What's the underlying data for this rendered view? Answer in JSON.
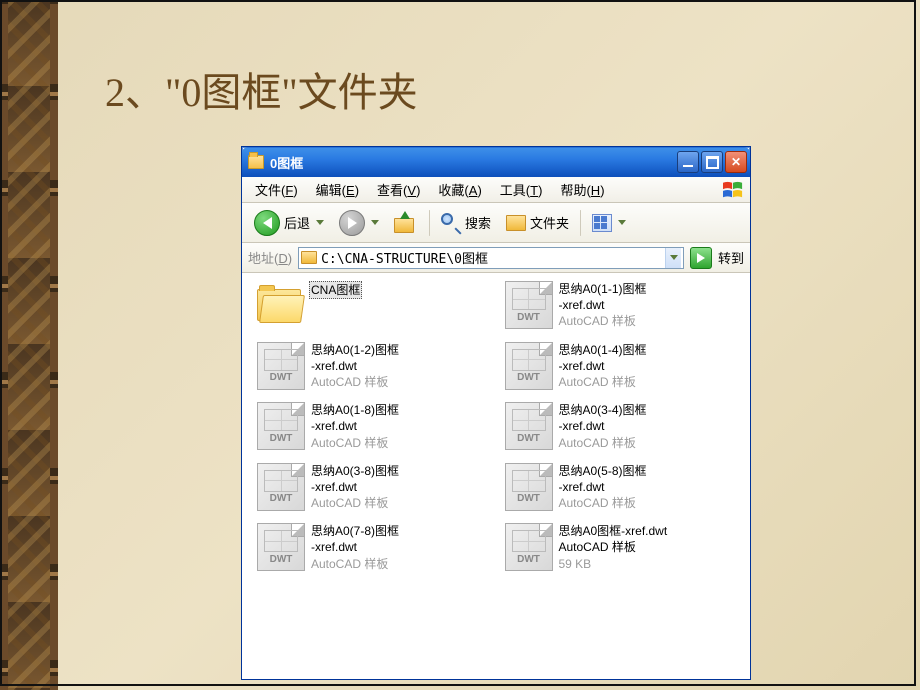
{
  "slide": {
    "title": "2、\"0图框\"文件夹"
  },
  "window": {
    "caption": "0图框"
  },
  "menu": {
    "file": "文件",
    "file_key": "F",
    "edit": "编辑",
    "edit_key": "E",
    "view": "查看",
    "view_key": "V",
    "fav": "收藏",
    "fav_key": "A",
    "tool": "工具",
    "tool_key": "T",
    "help": "帮助",
    "help_key": "H"
  },
  "toolbar": {
    "back": "后退",
    "search": "搜索",
    "folders": "文件夹"
  },
  "address": {
    "label": "地址",
    "label_key": "D",
    "path": "C:\\CNA-STRUCTURE\\0图框",
    "go": "转到"
  },
  "files": [
    {
      "type": "folder",
      "name": "CNA图框",
      "selected": true
    },
    {
      "type": "dwt",
      "name": "思纳A0(1-1)图框",
      "line2": "-xref.dwt",
      "kind": "AutoCAD 样板"
    },
    {
      "type": "dwt",
      "name": "思纳A0(1-2)图框",
      "line2": "-xref.dwt",
      "kind": "AutoCAD 样板"
    },
    {
      "type": "dwt",
      "name": "思纳A0(1-4)图框",
      "line2": "-xref.dwt",
      "kind": "AutoCAD 样板"
    },
    {
      "type": "dwt",
      "name": "思纳A0(1-8)图框",
      "line2": "-xref.dwt",
      "kind": "AutoCAD 样板"
    },
    {
      "type": "dwt",
      "name": "思纳A0(3-4)图框",
      "line2": "-xref.dwt",
      "kind": "AutoCAD 样板"
    },
    {
      "type": "dwt",
      "name": "思纳A0(3-8)图框",
      "line2": "-xref.dwt",
      "kind": "AutoCAD 样板"
    },
    {
      "type": "dwt",
      "name": "思纳A0(5-8)图框",
      "line2": "-xref.dwt",
      "kind": "AutoCAD 样板"
    },
    {
      "type": "dwt",
      "name": "思纳A0(7-8)图框",
      "line2": "-xref.dwt",
      "kind": "AutoCAD 样板"
    },
    {
      "type": "dwt",
      "name": "思纳A0图框-xref.dwt",
      "line2": "AutoCAD 样板",
      "kind": "59 KB"
    }
  ],
  "icons": {
    "dwt_label": "DWT"
  }
}
